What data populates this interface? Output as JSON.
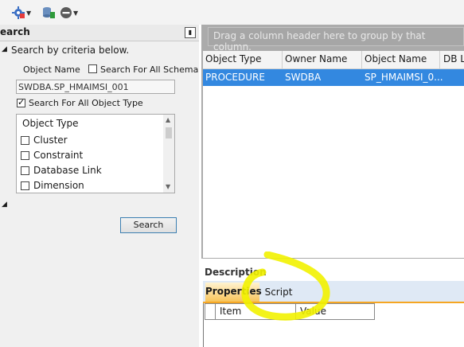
{
  "toolbar": {
    "icons": [
      "settings-gear-icon",
      "dropdown-chevron-icon",
      "database-sync-icon",
      "remove-icon",
      "dropdown-chevron-icon"
    ]
  },
  "search_panel": {
    "title": "earch",
    "instruction": "Search by criteria below.",
    "object_name_label": "Object Name",
    "object_name_value": "SWDBA.SP_HMAIMSI_001",
    "search_all_schema_label": "Search For All Schema",
    "search_all_schema_checked": false,
    "search_all_type_label": "Search For All Object Type",
    "search_all_type_checked": true,
    "object_type_header": "Object Type",
    "object_types": [
      "Cluster",
      "Constraint",
      "Database Link",
      "Dimension"
    ],
    "search_button": "Search"
  },
  "grid": {
    "group_hint": "Drag a column header here to group by that column.",
    "columns": [
      "Object Type",
      "Owner Name",
      "Object Name",
      "DB L"
    ],
    "rows": [
      [
        "PROCEDURE",
        "SWDBA",
        "SP_HMAIMSI_0..."
      ]
    ]
  },
  "description": {
    "label": "Description",
    "tabs": [
      "Properties",
      "Script"
    ],
    "active_tab": "Properties",
    "columns": [
      "Item",
      "Value"
    ]
  },
  "colors": {
    "selection": "#3388e0",
    "grid_background": "#ababab",
    "highlight": "#f2f200",
    "active_tab_accent": "#f5a623"
  }
}
